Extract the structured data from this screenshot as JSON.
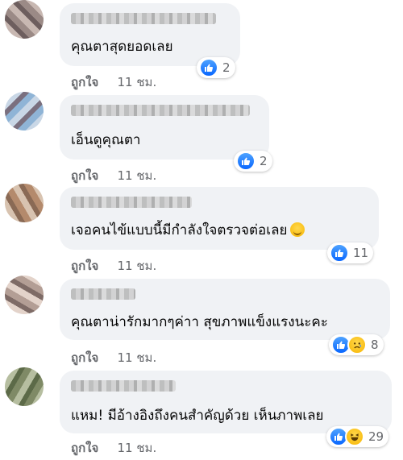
{
  "comments": [
    {
      "text": "คุณตาสุดยอดเลย",
      "count": "2",
      "like_label": "ถูกใจ",
      "time": "11 ชม."
    },
    {
      "text": "เอ็นดูคุณตา",
      "count": "2",
      "like_label": "ถูกใจ",
      "time": "11 ชม."
    },
    {
      "text": "เจอคนไข้แบบนี้มีกำลังใจตรวจต่อเลย",
      "count": "11",
      "like_label": "ถูกใจ",
      "time": "11 ชม."
    },
    {
      "text": "คุณตาน่ารักมากๆค่าา สุขภาพแข็งแรงนะคะ",
      "count": "8",
      "like_label": "ถูกใจ",
      "time": "11 ชม."
    },
    {
      "text": "แหม! มีอ้างอิงถึงคนสำคัญด้วย เห็นภาพเลย",
      "count": "29",
      "like_label": "ถูกใจ",
      "time": "11 ชม."
    }
  ],
  "colors": {
    "like_blue": "#0866ff",
    "bubble": "#f0f2f5",
    "meta": "#65676b"
  }
}
